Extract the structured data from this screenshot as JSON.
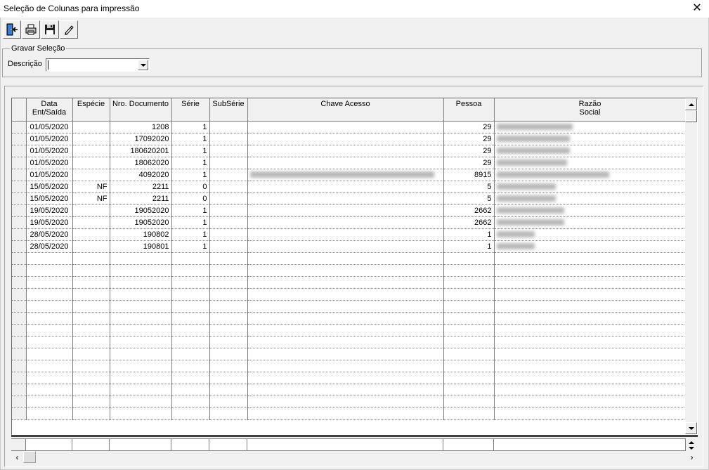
{
  "window": {
    "title": "Seleção de Colunas para impressão",
    "close_glyph": "✕"
  },
  "toolbar": {
    "buttons": [
      {
        "name": "exit-button",
        "icon": "door-exit-icon"
      },
      {
        "name": "print-button",
        "icon": "printer-icon"
      },
      {
        "name": "save-button",
        "icon": "floppy-disk-icon"
      },
      {
        "name": "edit-button",
        "icon": "pencil-icon"
      }
    ]
  },
  "selection_group": {
    "legend": "Gravar Seleção",
    "description_label": "Descrição",
    "description_value": ""
  },
  "grid": {
    "columns": [
      "Data\nEnt/Saída",
      "Espécie",
      "Nro. Documento",
      "Série",
      "SubSérie",
      "Chave Acesso",
      "Pessoa",
      "Razão\nSocial"
    ],
    "rows": [
      {
        "data": "01/05/2020",
        "especie": "",
        "nro": "1208",
        "serie": "1",
        "subserie": "",
        "chave_blurred": false,
        "pessoa": "29"
      },
      {
        "data": "01/05/2020",
        "especie": "",
        "nro": "17092020",
        "serie": "1",
        "subserie": "",
        "chave_blurred": false,
        "pessoa": "29"
      },
      {
        "data": "01/05/2020",
        "especie": "",
        "nro": "180620201",
        "serie": "1",
        "subserie": "",
        "chave_blurred": false,
        "pessoa": "29"
      },
      {
        "data": "01/05/2020",
        "especie": "",
        "nro": "18062020",
        "serie": "1",
        "subserie": "",
        "chave_blurred": false,
        "pessoa": "29"
      },
      {
        "data": "01/05/2020",
        "especie": "",
        "nro": "4092020",
        "serie": "1",
        "subserie": "",
        "chave_blurred": true,
        "pessoa": "8915"
      },
      {
        "data": "15/05/2020",
        "especie": "NF",
        "nro": "2211",
        "serie": "0",
        "subserie": "",
        "chave_blurred": false,
        "pessoa": "5"
      },
      {
        "data": "15/05/2020",
        "especie": "NF",
        "nro": "2211",
        "serie": "0",
        "subserie": "",
        "chave_blurred": false,
        "pessoa": "5"
      },
      {
        "data": "19/05/2020",
        "especie": "",
        "nro": "19052020",
        "serie": "1",
        "subserie": "",
        "chave_blurred": false,
        "pessoa": "2662"
      },
      {
        "data": "19/05/2020",
        "especie": "",
        "nro": "19052020",
        "serie": "1",
        "subserie": "",
        "chave_blurred": false,
        "pessoa": "2662"
      },
      {
        "data": "28/05/2020",
        "especie": "",
        "nro": "190802",
        "serie": "1",
        "subserie": "",
        "chave_blurred": false,
        "pessoa": "1"
      },
      {
        "data": "28/05/2020",
        "especie": "",
        "nro": "190801",
        "serie": "1",
        "subserie": "",
        "chave_blurred": false,
        "pessoa": "1"
      }
    ],
    "empty_rows": 14
  },
  "colors": {
    "window_bg": "#f0f0f0",
    "grid_bg": "#ffffff",
    "grid_line": "#808080"
  }
}
